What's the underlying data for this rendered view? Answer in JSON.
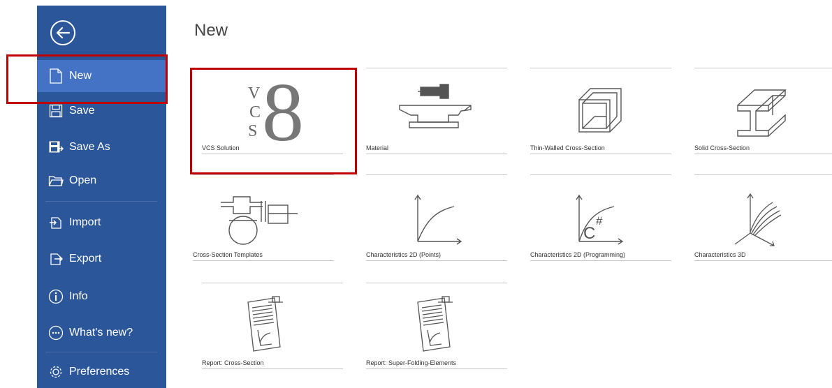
{
  "backstage": {
    "title": "New",
    "nav": [
      {
        "label": "New",
        "icon": "new-document-icon",
        "active": true
      },
      {
        "label": "Save",
        "icon": "save-icon"
      },
      {
        "label": "Save As",
        "icon": "save-as-icon"
      },
      {
        "label": "Open",
        "icon": "open-folder-icon"
      },
      {
        "label": "Import",
        "icon": "import-icon"
      },
      {
        "label": "Export",
        "icon": "export-icon"
      },
      {
        "label": "Info",
        "icon": "info-icon"
      },
      {
        "label": "What's new?",
        "icon": "whats-new-icon"
      },
      {
        "label": "Preferences",
        "icon": "preferences-icon"
      }
    ],
    "templates": [
      {
        "label": "VCS Solution",
        "icon": "vcs-logo-icon"
      },
      {
        "label": "Material",
        "icon": "anvil-icon"
      },
      {
        "label": "Thin-Walled Cross-Section",
        "icon": "thin-walled-section-icon"
      },
      {
        "label": "Solid Cross-Section",
        "icon": "solid-i-beam-icon"
      },
      {
        "label": "Cross-Section Templates",
        "icon": "section-templates-icon"
      },
      {
        "label": "Characteristics 2D (Points)",
        "icon": "curve-2d-icon"
      },
      {
        "label": "Characteristics 2D (Programming)",
        "icon": "curve-2d-programming-icon"
      },
      {
        "label": "Characteristics 3D",
        "icon": "curves-3d-icon"
      },
      {
        "label": "Report: Cross-Section",
        "icon": "report-icon"
      },
      {
        "label": "Report: Super-Folding-Elements",
        "icon": "report-icon"
      }
    ],
    "logo_letters": [
      "V",
      "C",
      "S"
    ],
    "logo_number": "8",
    "c_sharp_text": "C",
    "c_sharp_hash": "#"
  },
  "colors": {
    "sidebar": "#2b579a",
    "active": "#4472c4",
    "highlight": "#c00000"
  }
}
